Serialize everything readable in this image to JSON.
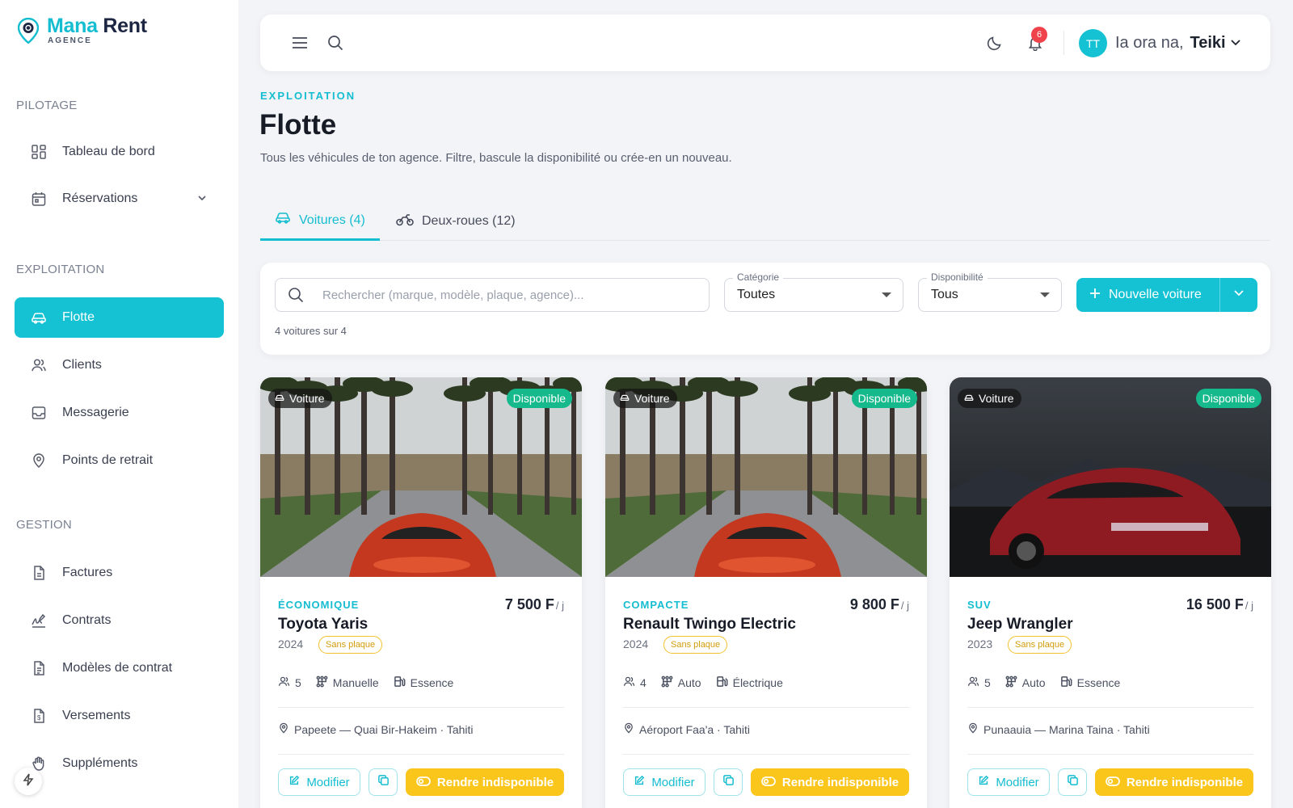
{
  "app": {
    "logo_name_1": "Mana",
    "logo_name_2": "Rent",
    "logo_sub": "AGENCE",
    "accent_color": "#14c2d3"
  },
  "sidebar": {
    "sections": [
      {
        "title": "PILOTAGE"
      },
      {
        "title": "EXPLOITATION"
      },
      {
        "title": "GESTION"
      }
    ],
    "items": [
      {
        "label": "Tableau de bord",
        "icon": "dashboard-icon"
      },
      {
        "label": "Réservations",
        "icon": "calendar-icon"
      },
      {
        "label": "Flotte",
        "icon": "car-icon",
        "active": true
      },
      {
        "label": "Clients",
        "icon": "users-icon"
      },
      {
        "label": "Messagerie",
        "icon": "inbox-icon"
      },
      {
        "label": "Points de retrait",
        "icon": "map-pin-icon"
      },
      {
        "label": "Factures",
        "icon": "invoice-icon"
      },
      {
        "label": "Contrats",
        "icon": "signature-icon"
      },
      {
        "label": "Modèles de contrat",
        "icon": "document-icon"
      },
      {
        "label": "Versements",
        "icon": "payment-icon"
      },
      {
        "label": "Suppléments",
        "icon": "hand-icon"
      }
    ]
  },
  "header": {
    "notification_count": "6",
    "avatar_initials": "TT",
    "greeting": "Ia ora na,",
    "user_name": "Teiki"
  },
  "page": {
    "overline": "EXPLOITATION",
    "title": "Flotte",
    "subtitle": "Tous les véhicules de ton agence. Filtre, bascule la disponibilité ou crée-en un nouveau."
  },
  "tabs": [
    {
      "label": "Voitures (4)",
      "active": true
    },
    {
      "label": "Deux-roues (12)",
      "active": false
    }
  ],
  "filters": {
    "search_placeholder": "Rechercher (marque, modèle, plaque, agence)...",
    "category_label": "Catégorie",
    "category_value": "Toutes",
    "availability_label": "Disponibilité",
    "availability_value": "Tous",
    "new_button_label": "Nouvelle voiture",
    "count_text": "4 voitures sur 4"
  },
  "cards": [
    {
      "type_chip": "Voiture",
      "status": "Disponible",
      "category": "ÉCONOMIQUE",
      "price": "7 500 F",
      "price_unit": "/ j",
      "name": "Toyota Yaris",
      "year": "2024",
      "plate_tag": "Sans plaque",
      "seats": "5",
      "transmission": "Manuelle",
      "fuel": "Essence",
      "location": "Papeete — Quai Bir-Hakeim · Tahiti",
      "edit_label": "Modifier",
      "unavail_label": "Rendre indisponible",
      "image_scene": "street"
    },
    {
      "type_chip": "Voiture",
      "status": "Disponible",
      "category": "COMPACTE",
      "price": "9 800 F",
      "price_unit": "/ j",
      "name": "Renault Twingo Electric",
      "year": "2024",
      "plate_tag": "Sans plaque",
      "seats": "4",
      "transmission": "Auto",
      "fuel": "Électrique",
      "location": "Aéroport Faa'a · Tahiti",
      "edit_label": "Modifier",
      "unavail_label": "Rendre indisponible",
      "image_scene": "street"
    },
    {
      "type_chip": "Voiture",
      "status": "Disponible",
      "category": "SUV",
      "price": "16 500 F",
      "price_unit": "/ j",
      "name": "Jeep Wrangler",
      "year": "2023",
      "plate_tag": "Sans plaque",
      "seats": "5",
      "transmission": "Auto",
      "fuel": "Essence",
      "location": "Punaauia — Marina Taina · Tahiti",
      "edit_label": "Modifier",
      "unavail_label": "Rendre indisponible",
      "image_scene": "dark"
    }
  ]
}
